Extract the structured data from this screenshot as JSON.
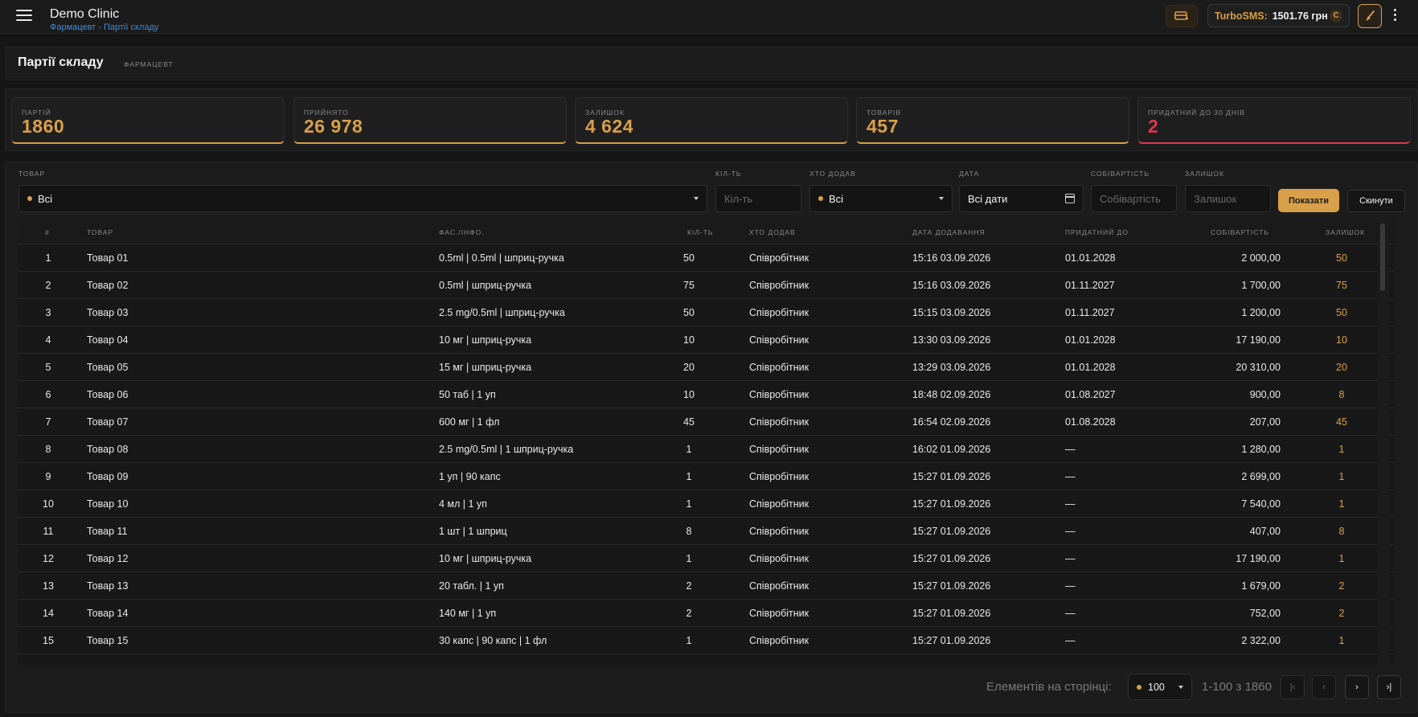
{
  "app": {
    "title": "Demo Clinic",
    "breadcrumb": "Фармацевт - Партії складу"
  },
  "topbar": {
    "sms_label": "TurboSMS:",
    "sms_balance": "1501.76 грн",
    "sms_coin": "C"
  },
  "page": {
    "title": "Партії складу",
    "role": "ФАРМАЦЕВТ"
  },
  "stats": [
    {
      "label": "ПАРТІЙ",
      "value": "1860"
    },
    {
      "label": "ПРИЙНЯТО",
      "value": "26 978"
    },
    {
      "label": "ЗАЛИШОК",
      "value": "4 624"
    },
    {
      "label": "ТОВАРІВ",
      "value": "457"
    },
    {
      "label": "ПРИДАТНИЙ ДО 30 ДНІВ",
      "value": "2"
    }
  ],
  "filters": {
    "product_label": "ТОВАР",
    "product_value": "Всі",
    "qty_label": "КІЛ-ТЬ",
    "qty_placeholder": "Кіл-ть",
    "added_by_label": "ХТО ДОДАВ",
    "added_by_value": "Всі",
    "date_label": "ДАТА",
    "date_value": "Всі дати",
    "cost_label": "СОБІВАРТІСТЬ",
    "cost_placeholder": "Собівартість",
    "stock_label": "ЗАЛИШОК",
    "stock_placeholder": "Залишок",
    "show_button": "Показати",
    "reset_button": "Скинути"
  },
  "table": {
    "headers": [
      "#",
      "ТОВАР",
      "ФАС./ІНФО.",
      "КІЛ-ТЬ",
      "ХТО ДОДАВ",
      "ДАТА ДОДАВАННЯ",
      "ПРИДАТНИЙ ДО",
      "СОБІВАРТІСТЬ",
      "ЗАЛИШОК"
    ],
    "rows": [
      [
        "1",
        "Товар 01",
        "0.5ml | 0.5ml | шприц-ручка",
        "50",
        "Співробітник",
        "15:16 03.09.2026",
        "01.01.2028",
        "2 000,00",
        "50"
      ],
      [
        "2",
        "Товар 02",
        "0.5ml | шприц-ручка",
        "75",
        "Співробітник",
        "15:16 03.09.2026",
        "01.11.2027",
        "1 700,00",
        "75"
      ],
      [
        "3",
        "Товар 03",
        "2.5 mg/0.5ml | шприц-ручка",
        "50",
        "Співробітник",
        "15:15 03.09.2026",
        "01.11.2027",
        "1 200,00",
        "50"
      ],
      [
        "4",
        "Товар 04",
        "10 мг | шприц-ручка",
        "10",
        "Співробітник",
        "13:30 03.09.2026",
        "01.01.2028",
        "17 190,00",
        "10"
      ],
      [
        "5",
        "Товар 05",
        "15 мг | шприц-ручка",
        "20",
        "Співробітник",
        "13:29 03.09.2026",
        "01.01.2028",
        "20 310,00",
        "20"
      ],
      [
        "6",
        "Товар 06",
        "50 таб | 1 уп",
        "10",
        "Співробітник",
        "18:48 02.09.2026",
        "01.08.2027",
        "900,00",
        "8"
      ],
      [
        "7",
        "Товар 07",
        "600 мг | 1 фл",
        "45",
        "Співробітник",
        "16:54 02.09.2026",
        "01.08.2028",
        "207,00",
        "45"
      ],
      [
        "8",
        "Товар 08",
        "2.5 mg/0.5ml | 1 шприц-ручка",
        "1",
        "Співробітник",
        "16:02 01.09.2026",
        "—",
        "1 280,00",
        "1"
      ],
      [
        "9",
        "Товар 09",
        "1 уп | 90 капс",
        "1",
        "Співробітник",
        "15:27 01.09.2026",
        "—",
        "2 699,00",
        "1"
      ],
      [
        "10",
        "Товар 10",
        "4 мл | 1 уп",
        "1",
        "Співробітник",
        "15:27 01.09.2026",
        "—",
        "7 540,00",
        "1"
      ],
      [
        "11",
        "Товар 11",
        "1 шт | 1 шприц",
        "8",
        "Співробітник",
        "15:27 01.09.2026",
        "—",
        "407,00",
        "8"
      ],
      [
        "12",
        "Товар 12",
        "10 мг | шприц-ручка",
        "1",
        "Співробітник",
        "15:27 01.09.2026",
        "—",
        "17 190,00",
        "1"
      ],
      [
        "13",
        "Товар 13",
        "20 табл. | 1 уп",
        "2",
        "Співробітник",
        "15:27 01.09.2026",
        "—",
        "1 679,00",
        "2"
      ],
      [
        "14",
        "Товар 14",
        "140 мг | 1 уп",
        "2",
        "Співробітник",
        "15:27 01.09.2026",
        "—",
        "752,00",
        "2"
      ],
      [
        "15",
        "Товар 15",
        "30 капс | 90 капс | 1 фл",
        "1",
        "Співробітник",
        "15:27 01.09.2026",
        "—",
        "2 322,00",
        "1"
      ]
    ]
  },
  "pagination": {
    "items_label": "Елементів на сторінці:",
    "page_size": "100",
    "range": "1-100 з 1860",
    "first": "|‹",
    "prev": "‹",
    "next": "›",
    "last": "›|"
  }
}
